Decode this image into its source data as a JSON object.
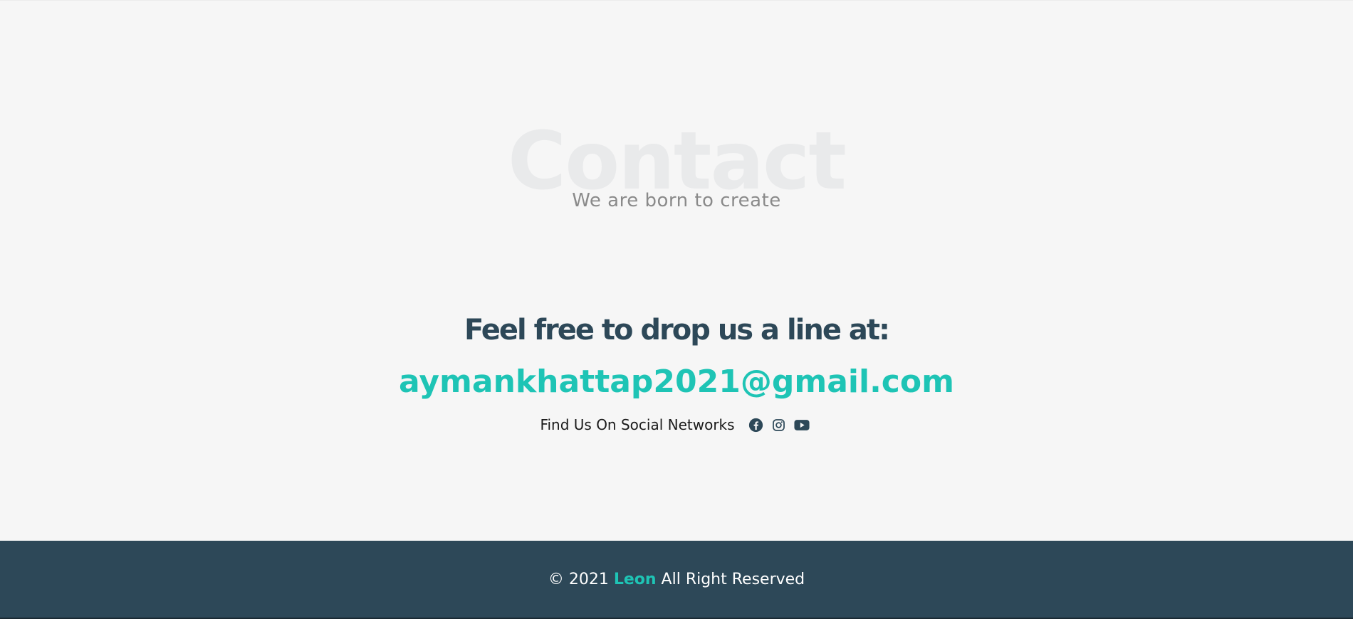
{
  "contact": {
    "background_title": "Contact",
    "subtitle": "We are born to create",
    "heading": "Feel free to drop us a line at:",
    "email": "aymankhattap2021@gmail.com",
    "social_label": "Find Us On Social Networks",
    "social_icons": [
      "facebook-icon",
      "instagram-icon",
      "youtube-icon"
    ]
  },
  "footer": {
    "copyright_prefix": "© 2021",
    "brand": "Leon",
    "copyright_suffix": "All Right Reserved"
  },
  "colors": {
    "background": "#f6f6f6",
    "heading": "#2d4858",
    "accent": "#1ec4b5",
    "footer_bg": "#2d4858",
    "subtitle": "#8a8a8a",
    "bg_title": "#e9eaeb"
  }
}
